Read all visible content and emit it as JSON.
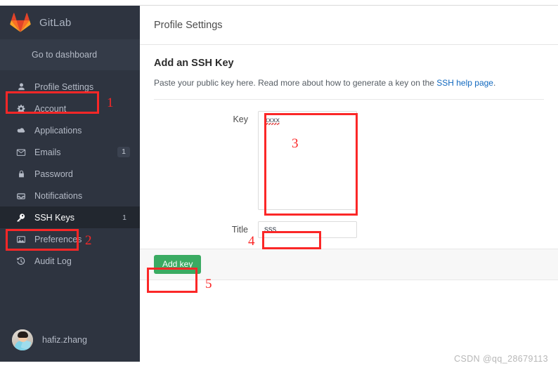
{
  "sidebar": {
    "brand": {
      "name": "GitLab",
      "logo_icon": "gitlab-tanuki-logo"
    },
    "dashboard_link": "Go to dashboard",
    "items": [
      {
        "label": "Profile Settings",
        "icon": "user-icon",
        "badge": "",
        "count": "",
        "active": false
      },
      {
        "label": "Account",
        "icon": "gear-icon",
        "badge": "",
        "count": "",
        "active": false
      },
      {
        "label": "Applications",
        "icon": "cloud-icon",
        "badge": "",
        "count": "",
        "active": false
      },
      {
        "label": "Emails",
        "icon": "envelope-icon",
        "badge": "1",
        "count": "",
        "active": false
      },
      {
        "label": "Password",
        "icon": "lock-icon",
        "badge": "",
        "count": "",
        "active": false
      },
      {
        "label": "Notifications",
        "icon": "inbox-icon",
        "badge": "",
        "count": "",
        "active": false
      },
      {
        "label": "SSH Keys",
        "icon": "key-icon",
        "badge": "",
        "count": "1",
        "active": true
      },
      {
        "label": "Preferences",
        "icon": "image-icon",
        "badge": "",
        "count": "",
        "active": false
      },
      {
        "label": "Audit Log",
        "icon": "history-icon",
        "badge": "",
        "count": "",
        "active": false
      }
    ],
    "user": {
      "name": "hafiz.zhang",
      "avatar_icon": "user-avatar-photo"
    }
  },
  "header": {
    "title": "Profile Settings"
  },
  "main": {
    "section_title": "Add an SSH Key",
    "description_before": "Paste your public key here. Read more about how to generate a key on the ",
    "description_link": "SSH help page",
    "description_after": ".",
    "form": {
      "key_label": "Key",
      "key_value": "xxxx",
      "key_placeholder": "",
      "title_label": "Title",
      "title_value": "sss",
      "title_placeholder": "",
      "submit_label": "Add key"
    }
  },
  "annotations": {
    "markers": [
      "1",
      "2",
      "3",
      "4",
      "5"
    ],
    "color": "#fb2727"
  },
  "watermark": "CSDN @qq_28679113",
  "colors": {
    "sidebar_bg": "#2e3440",
    "sidebar_active_bg": "#22272f",
    "accent_green": "#3aab62",
    "link_blue": "#1068bf",
    "annotation_red": "#fb2727"
  }
}
